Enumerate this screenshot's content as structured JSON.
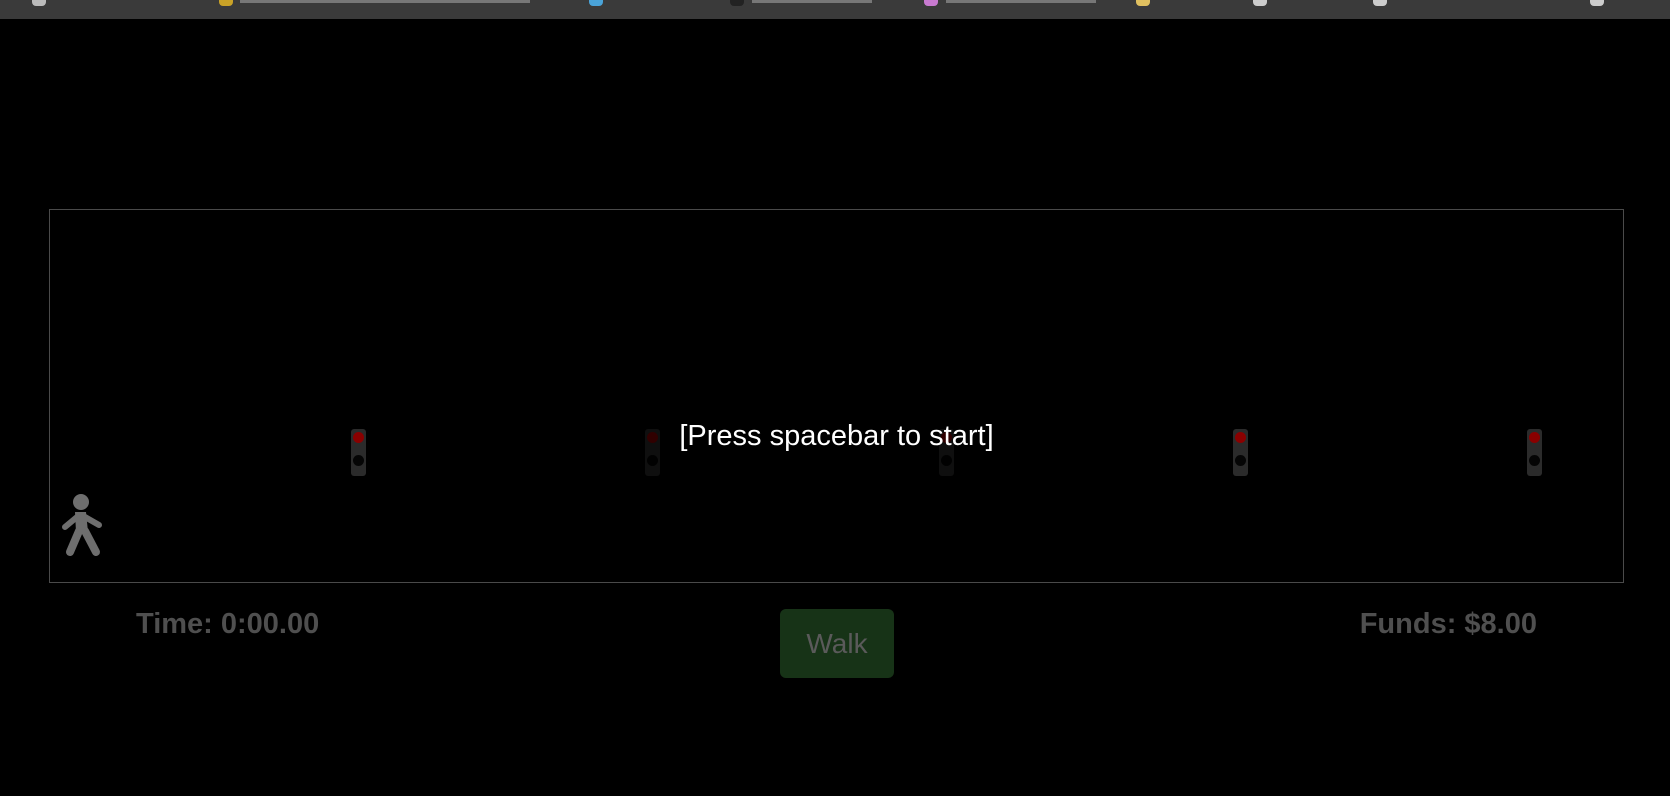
{
  "game": {
    "prompt": "[Press spacebar to start]",
    "time_label": "Time: 0:00.00",
    "funds_label": "Funds: $8.00",
    "walk_button": "Walk"
  },
  "traffic_lights": [
    {
      "state": "red"
    },
    {
      "state": "red"
    },
    {
      "state": "red"
    },
    {
      "state": "red"
    },
    {
      "state": "red"
    }
  ],
  "colors": {
    "background": "#000000",
    "light_red": "#8a0000",
    "walk_button": "#173317",
    "hud_text": "#4f4f4f"
  }
}
